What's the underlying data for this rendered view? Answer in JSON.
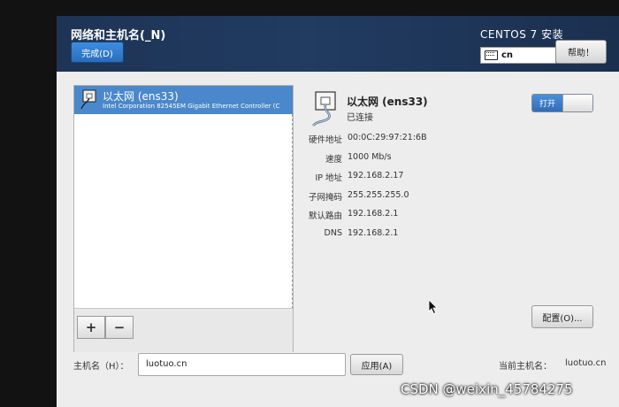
{
  "header": {
    "title": "网络和主机名(_N)",
    "done_label": "完成(D)",
    "product": "CENTOS 7 安装",
    "keyboard_layout": "cn",
    "help_label": "帮助！"
  },
  "connections": [
    {
      "name": "以太网 (ens33)",
      "description": "Intel Corporation 82545EM Gigabit Ethernet Controller (C"
    }
  ],
  "list_toolbar": {
    "add_label": "+",
    "remove_label": "−"
  },
  "device": {
    "name": "以太网 (ens33)",
    "status": "已连接",
    "toggle_label": "打开",
    "details": [
      {
        "label": "硬件地址",
        "value": "00:0C:29:97:21:6B"
      },
      {
        "label": "速度",
        "value": "1000 Mb/s"
      },
      {
        "label": "IP 地址",
        "value": "192.168.2.17"
      },
      {
        "label": "子网掩码",
        "value": "255.255.255.0"
      },
      {
        "label": "默认路由",
        "value": "192.168.2.1"
      },
      {
        "label": "DNS",
        "value": "192.168.2.1"
      }
    ],
    "configure_label": "配置(O)..."
  },
  "hostname": {
    "label": "主机名（H）：",
    "value": "luotuo.cn",
    "apply_label": "应用(A)",
    "current_label": "当前主机名：",
    "current_value": "luotuo.cn"
  },
  "watermark": "CSDN @weixin_45784275"
}
